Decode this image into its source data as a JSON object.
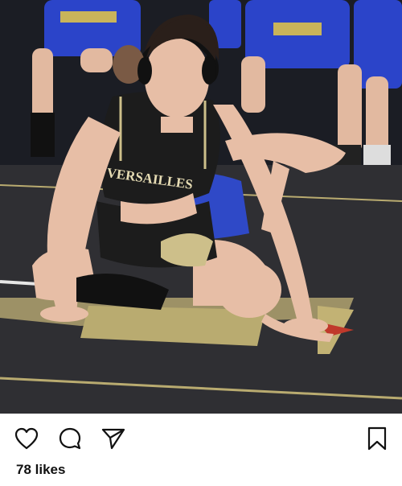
{
  "post": {
    "photo_alt": "Two wrestlers on a mat in referee's position, one in a black singlet reading VERSAILLES, teammates in blue seated in background",
    "singlet_text": "VERSAILLES",
    "likes_text": "78 likes"
  },
  "icons": {
    "like": "heart-icon",
    "comment": "comment-bubble-icon",
    "share": "paper-plane-icon",
    "save": "bookmark-icon"
  },
  "colors": {
    "background": "#ffffff",
    "text": "#111111",
    "mat": "#2f2f33",
    "mat_accent": "#b9ab70",
    "singlet": "#1c1c1c",
    "singlet_trim": "#cdbf8a",
    "opponent": "#2f49c7",
    "bench_uniform": "#2b44c9"
  }
}
